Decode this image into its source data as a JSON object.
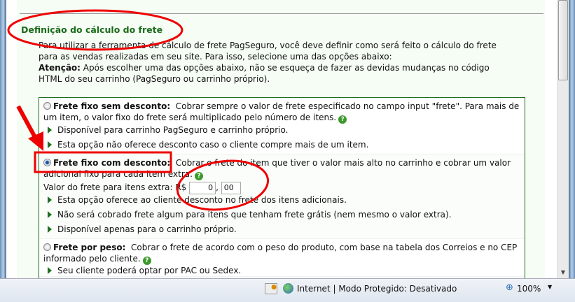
{
  "section_title": "Definição do cálculo do frete",
  "intro": {
    "line1": "Para utilizar a ferramenta de cálculo de frete PagSeguro, você deve definir como será feito o cálculo do frete",
    "line2": "para as vendas realizadas em seu site. Para isso, selecione uma das opções abaixo:",
    "attention_label": "Atenção:",
    "attention_text": " Após escolher uma das opções abaixo, não se esqueça de fazer as devidas mudanças no código",
    "line4": "HTML do seu carrinho (PagSeguro ou carrinho próprio)."
  },
  "options": [
    {
      "label": "Frete fixo sem desconto",
      "selected": false,
      "desc": "Cobrar sempre o valor de frete especificado no campo input \"frete\". Para mais de um item, o valor fixo do frete será multiplicado pelo número de itens.",
      "bullets": [
        "Disponível para carrinho PagSeguro e carrinho próprio.",
        "Esta opção não oferece desconto caso o cliente compre mais de um item."
      ]
    },
    {
      "label": "Frete fixo com desconto",
      "selected": true,
      "desc": "Cobrar o frete do item que tiver o valor mais alto no carrinho e cobrar um valor adicional fixo para cada item extra.",
      "extra_label": "Valor do frete para itens extra:",
      "currency": "R$",
      "value_int": "0",
      "separator": ",",
      "value_dec": "00",
      "bullets": [
        "Esta opção oferece ao cliente desconto no frete dos itens adicionais.",
        "Não será cobrado frete algum para itens que tenham frete grátis (nem mesmo o valor extra).",
        "Disponível apenas para o carrinho próprio."
      ]
    },
    {
      "label": "Frete por peso",
      "selected": false,
      "desc": "Cobrar o frete de acordo com o peso do produto, com base na tabela dos Correios e no CEP informado pelo cliente.",
      "bullets": [
        "Seu cliente poderá optar por PAC ou Sedex."
      ]
    }
  ],
  "colon": ":",
  "help_glyph": "?",
  "status": {
    "zone": "Internet | Modo Protegido: Desativado",
    "zoom": "100%"
  }
}
